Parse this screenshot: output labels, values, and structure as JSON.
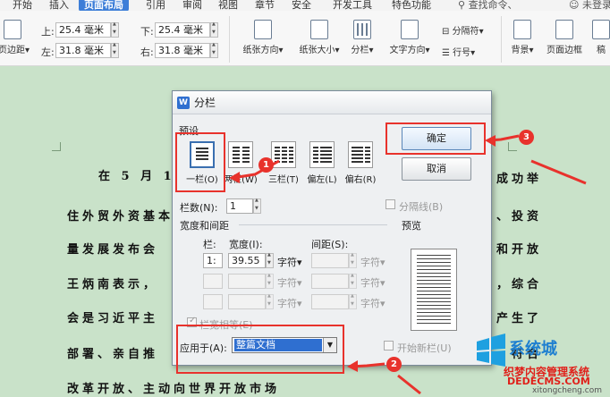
{
  "tabs": [
    "开始",
    "插入",
    "页面布局",
    "引用",
    "审阅",
    "视图",
    "章节",
    "安全",
    "开发工具",
    "特色功能"
  ],
  "active_tab": "页面布局",
  "search_hint": "查找命令、",
  "user_label": "未登录",
  "ribbon": {
    "margins_label": "页边距",
    "top_label": "上:",
    "top_value": "25.4 毫米",
    "bottom_label": "下:",
    "bottom_value": "25.4 毫米",
    "left_label": "左:",
    "left_value": "31.8 毫米",
    "right_label": "右:",
    "right_value": "31.8 毫米",
    "orientation_label": "纸张方向",
    "size_label": "纸张大小",
    "columns_label": "分栏",
    "text_direction_label": "文字方向",
    "separator_label": "分隔符",
    "line_number_label": "行号",
    "background_label": "背景",
    "page_border_label": "页面边框",
    "more_label": "稿"
  },
  "document": {
    "lines": [
      "在 5 月 18 (",
      "住外贸外资基本",
      "量发展发布会",
      "王炳南表示，",
      "会是习近平主",
      "部署、亲自推",
      "改革开放、主动向世界开放市场"
    ],
    "right_fragments": [
      "成功举",
      "、投资",
      "和开放",
      "，综合",
      "产生了",
      "、符合"
    ]
  },
  "dialog": {
    "title": "分栏",
    "preset_label": "预设",
    "presets": [
      "一栏(O)",
      "两栏(W)",
      "三栏(T)",
      "偏左(L)",
      "偏右(R)"
    ],
    "ok_label": "确定",
    "cancel_label": "取消",
    "columns_count_label": "栏数(N):",
    "columns_count_value": "1",
    "separator_line_label": "分隔线(B)",
    "width_spacing_label": "宽度和间距",
    "col_header": "栏:",
    "width_header": "宽度(I):",
    "spacing_header": "间距(S):",
    "row1_col": "1:",
    "row1_width": "39.55",
    "unit_label": "字符",
    "equal_width_label": "栏宽相等(E)",
    "preview_label": "预览",
    "apply_to_label": "应用于(A):",
    "apply_to_value": "整篇文档",
    "new_column_label": "开始新栏(U)"
  },
  "annotations": {
    "badge1": "1",
    "badge2": "2",
    "badge3": "3"
  },
  "watermark": {
    "brand": "系统城",
    "line1": "织梦内容管理系统",
    "line2": "DEDECMS.COM",
    "domain": "xitongcheng.com"
  },
  "colors": {
    "accent": "#3d7ed8",
    "annotation_red": "#e8322c",
    "doc_bg": "#c9e2c9"
  }
}
